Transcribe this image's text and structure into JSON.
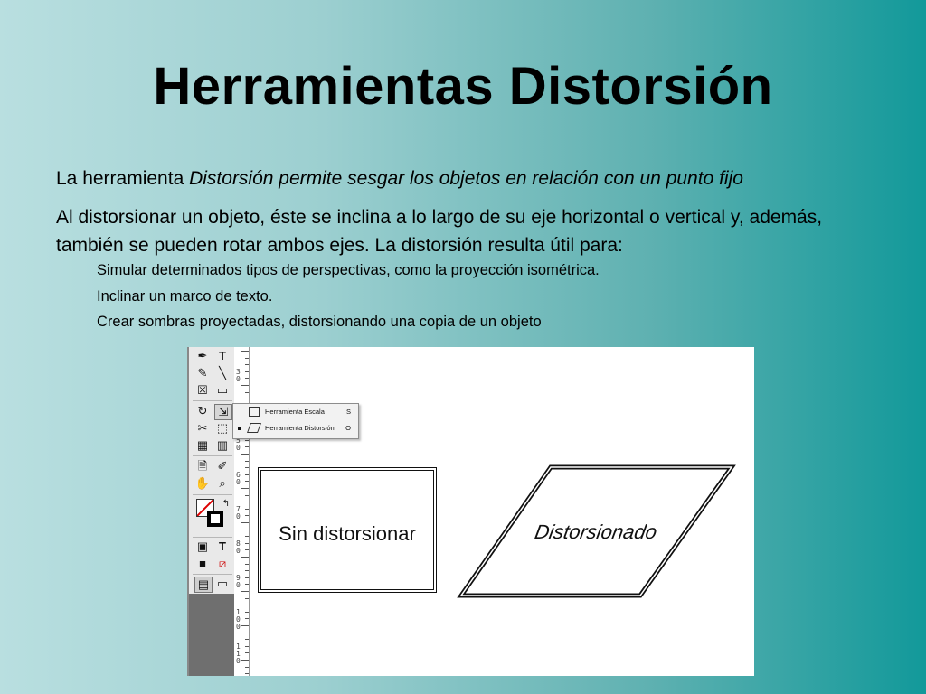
{
  "slide": {
    "title": "Herramientas Distorsión",
    "p1_prefix": "La herramienta ",
    "p1_italic": "Distorsión permite sesgar los objetos en relación con un punto fijo",
    "p2": "Al distorsionar un objeto, éste se inclina a lo largo de su eje horizontal o vertical y, además, también se pueden rotar ambos ejes. La distorsión resulta útil para:",
    "subitems": [
      "Simular determinados tipos de perspectivas, como la proyección isométrica.",
      "Inclinar un marco de texto.",
      "Crear sombras proyectadas, distorsionando una copia de un objeto"
    ]
  },
  "screenshot": {
    "flyout": [
      {
        "label": "Herramienta Escala",
        "shortcut": "S"
      },
      {
        "label": "Herramienta Distorsión",
        "shortcut": "O"
      }
    ],
    "ruler_numbers": [
      "3\n0",
      "4\n0",
      "5\n0",
      "6\n0",
      "7\n0",
      "8\n0",
      "9\n0",
      "1\n0\n0",
      "1\n1\n0"
    ],
    "box_plain_label": "Sin distorsionar",
    "box_skewed_label": "Distorsionado",
    "tools": {
      "type_tool": "T",
      "text_frame": "T"
    }
  },
  "colors": {
    "bg_left": "#b9dfe0",
    "bg_right": "#12999a"
  }
}
